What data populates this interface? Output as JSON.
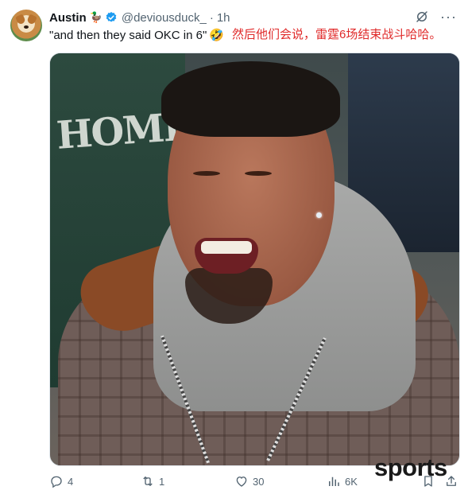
{
  "tweet": {
    "author_name": "Austin",
    "author_badge_emoji": "🦆",
    "handle": "@deviousduck_",
    "separator": "·",
    "time": "1h",
    "text": "\"and then they said OKC in 6\"",
    "text_emoji": "🤣",
    "overlay_caption": "然后他们会说，雷霆6场结束战斗哈哈。"
  },
  "icons": {
    "verified": "verified-badge-icon",
    "grok": "grok-icon",
    "more": "more-icon",
    "reply": "reply-icon",
    "retweet": "retweet-icon",
    "like": "heart-icon",
    "views": "views-icon",
    "bookmark": "bookmark-icon",
    "share": "share-icon"
  },
  "more_glyph": "···",
  "actions": {
    "replies": "4",
    "retweets": "1",
    "likes": "30",
    "views": "6K"
  },
  "watermark": "sports",
  "colors": {
    "accent": "#1d9bf0",
    "muted": "#536471",
    "caption_red": "#e02a2a"
  }
}
